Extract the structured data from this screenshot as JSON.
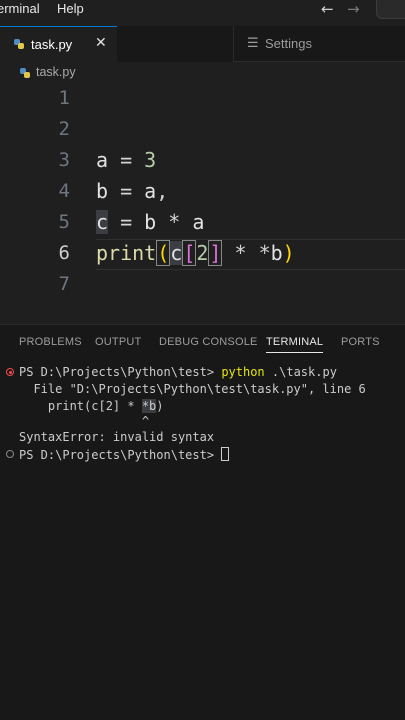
{
  "menubar": {
    "items": [
      "erminal",
      "Help"
    ]
  },
  "icons": {
    "nav_back": "arrow-left-icon",
    "nav_forward": "arrow-right-icon",
    "close": "close-icon",
    "settings": "gear-icon",
    "python": "python-file-icon"
  },
  "tabs": [
    {
      "label": "task.py",
      "active": true
    },
    {
      "label": "Settings",
      "active": false
    }
  ],
  "breadcrumb": {
    "file": "task.py"
  },
  "editor": {
    "current_line": 6,
    "line_numbers": [
      "1",
      "2",
      "3",
      "4",
      "5",
      "6",
      "7"
    ],
    "lines": [
      "",
      "",
      "a = 3",
      "b = a,",
      "c = b * a",
      "print(c[2] * *b)",
      ""
    ]
  },
  "panel": {
    "tabs": [
      "PROBLEMS",
      "OUTPUT",
      "DEBUG CONSOLE",
      "TERMINAL",
      "PORTS"
    ],
    "active_tab": "TERMINAL"
  },
  "terminal": {
    "prompt": "PS D:\\Projects\\Python\\test>",
    "command_name": "python",
    "command_args": " .\\task.py",
    "traceback_file": "  File \"D:\\Projects\\Python\\test\\task.py\", line 6",
    "traceback_code_pre": "    print(c[2] * ",
    "traceback_code_sel": "*b",
    "traceback_code_post": ")",
    "caret": "                 ^",
    "error": "SyntaxError: invalid syntax",
    "prompt2": "PS D:\\Projects\\Python\\test>"
  },
  "colors": {
    "accent": "#0078d4",
    "error_dot": "#f14c4c",
    "command": "#e5e510",
    "bracket_gold": "#ffd700",
    "bracket_purple": "#da70d6",
    "number": "#b5cea8",
    "function": "#dcdcaa"
  }
}
